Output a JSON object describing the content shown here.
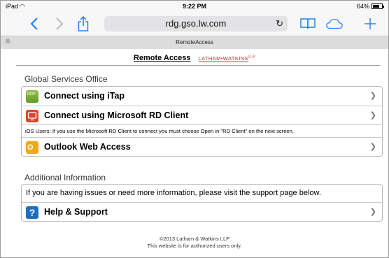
{
  "status_bar": {
    "device": "iPad",
    "time": "9:22 PM",
    "battery": "64%",
    "battery_level": 0.64
  },
  "browser": {
    "url": "rdg.gso.lw.com",
    "tab_title": "RemoteAccess",
    "icons": [
      "back-icon",
      "forward-icon",
      "share-icon",
      "reload-icon",
      "bookmarks-icon",
      "cloud-tabs-icon",
      "new-tab-icon",
      "close-tab-icon"
    ]
  },
  "header": {
    "title": "Remote Access",
    "brand": "LATHAM•WATKINS",
    "brand_suffix": "LLP"
  },
  "sections": {
    "global": {
      "title": "Global Services Office",
      "items": [
        {
          "label": "Connect using iTap",
          "icon": "rdp-icon"
        },
        {
          "label": "Connect using Microsoft RD Client",
          "icon": "rd-client-icon"
        },
        {
          "note": "iOS Users: If you use the Microsoft RD Client to connect you must choose Open in \"RD Client\" on the next screen."
        },
        {
          "label": "Outlook Web Access",
          "icon": "outlook-icon"
        }
      ]
    },
    "additional": {
      "title": "Additional Information",
      "info_text": "If you are having issues or need more information, please visit the support page below.",
      "help_label": "Help & Support"
    }
  },
  "footer": {
    "copyright": "©2013 Latham & Watkins LLP",
    "notice": "This website is for authorized users only."
  },
  "colors": {
    "accent_blue": "#1f7cf3",
    "brand_red": "#c8272e"
  }
}
